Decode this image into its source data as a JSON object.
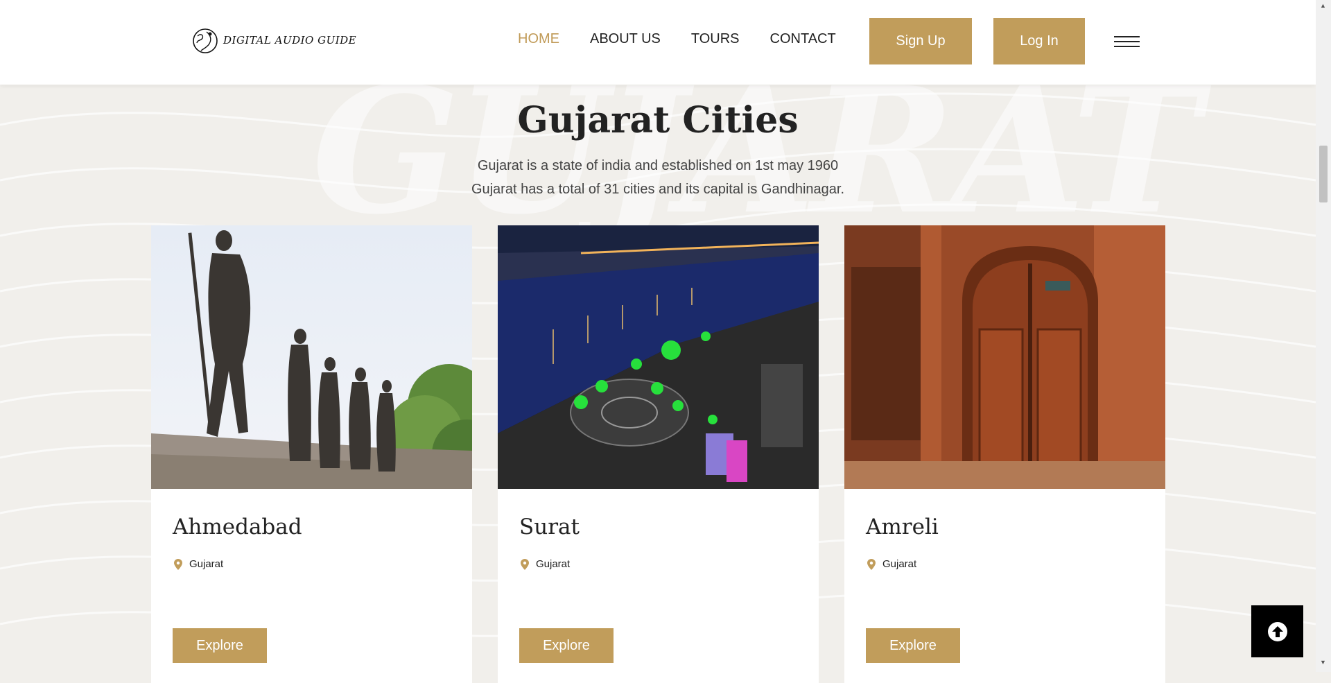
{
  "header": {
    "logo_text": "DIGITAL AUDIO GUIDE",
    "nav": [
      {
        "label": "HOME",
        "active": true
      },
      {
        "label": "ABOUT US",
        "active": false
      },
      {
        "label": "TOURS",
        "active": false
      },
      {
        "label": "CONTACT",
        "active": false
      }
    ],
    "signup_label": "Sign Up",
    "login_label": "Log In",
    "menu_icon": "hamburger-icon"
  },
  "hero": {
    "watermark": "GUJARAT",
    "title": "Gujarat Cities",
    "description_line1": "Gujarat is a state of india and established on 1st may 1960",
    "description_line2": "Gujarat has a total of 31 cities and its capital is Gandhinagar."
  },
  "cards": [
    {
      "name": "Ahmedabad",
      "location": "Gujarat",
      "button": "Explore"
    },
    {
      "name": "Surat",
      "location": "Gujarat",
      "button": "Explore"
    },
    {
      "name": "Amreli",
      "location": "Gujarat",
      "button": "Explore"
    }
  ],
  "scroll_top_icon": "arrow-up-circle-icon",
  "colors": {
    "accent": "#c19d5b",
    "active_nav": "#c09a57",
    "background": "#f1efeb"
  }
}
